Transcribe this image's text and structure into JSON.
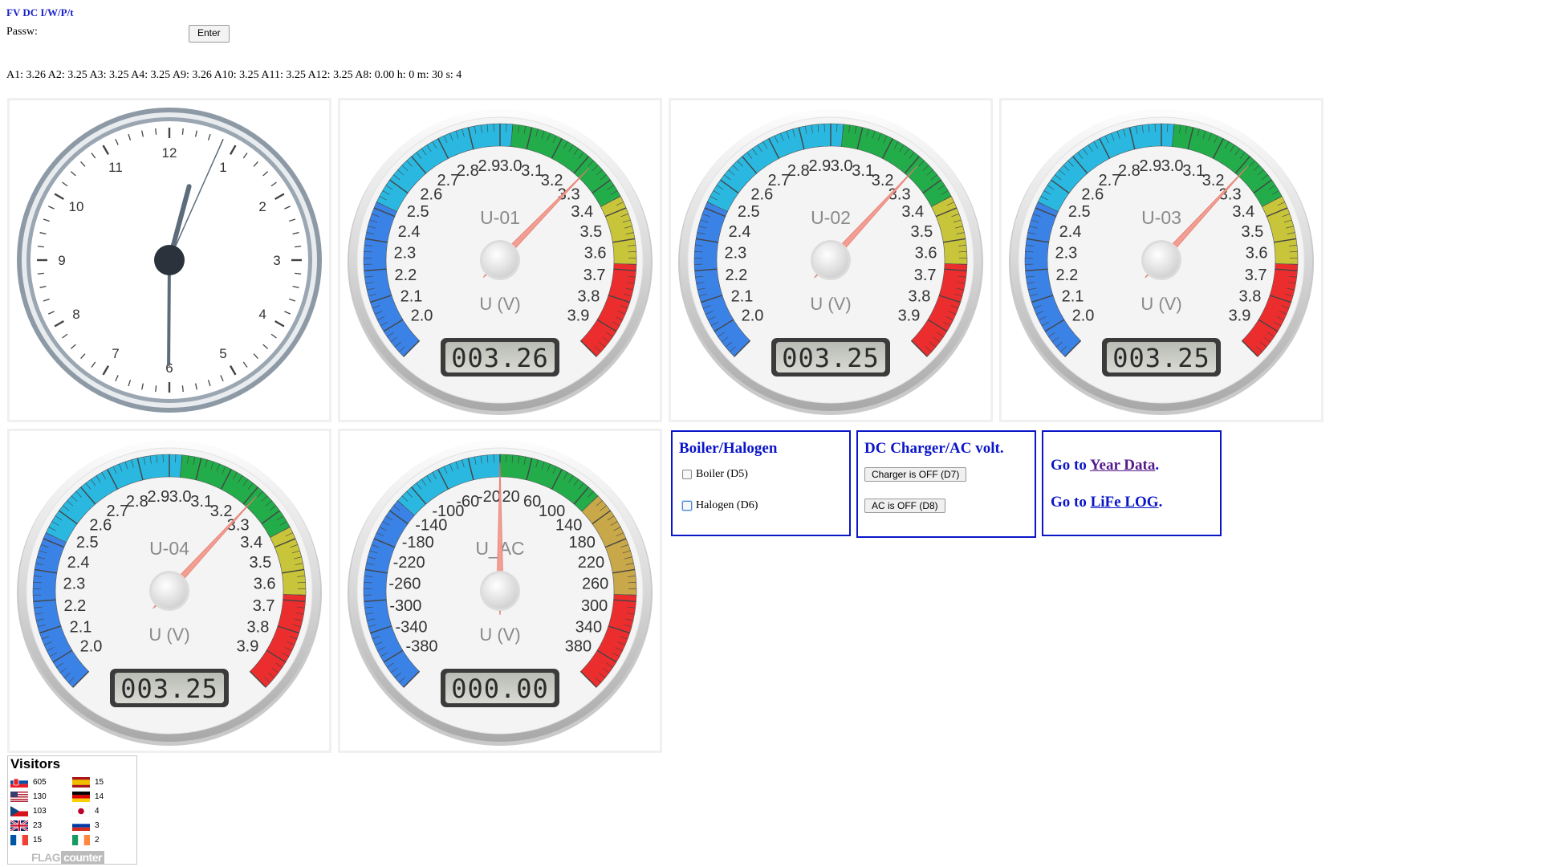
{
  "header": {
    "title": "FV DC I/W/P/t",
    "passw_label": "Passw:",
    "enter_label": "Enter"
  },
  "readings_line": "A1: 3.26 A2: 3.25 A3: 3.25 A4: 3.25 A9: 3.26 A10: 3.25 A11: 3.25 A12: 3.25 A8: 0.00 h: 0 m: 30 s: 4",
  "clock": {
    "numbers": [
      "12",
      "1",
      "2",
      "3",
      "4",
      "5",
      "6",
      "7",
      "8",
      "9",
      "10",
      "11"
    ],
    "hour": 0,
    "minute": 30,
    "second": 4
  },
  "gauges": [
    {
      "id": "U-01",
      "unit": "U (V)",
      "value": 3.26,
      "display": "003.26"
    },
    {
      "id": "U-02",
      "unit": "U (V)",
      "value": 3.25,
      "display": "003.25"
    },
    {
      "id": "U-03",
      "unit": "U (V)",
      "value": 3.25,
      "display": "003.25"
    },
    {
      "id": "U-04",
      "unit": "U (V)",
      "value": 3.25,
      "display": "003.25"
    },
    {
      "id": "U_AC",
      "unit": "U (V)",
      "value": 0.0,
      "display": "000.00"
    }
  ],
  "dc_scale": {
    "labels": [
      "2.0",
      "2.1",
      "2.2",
      "2.3",
      "2.4",
      "2.5",
      "2.6",
      "2.7",
      "2.8",
      "2.9",
      "3.0",
      "3.1",
      "3.2",
      "3.3",
      "3.4",
      "3.5",
      "3.6",
      "3.7",
      "3.8",
      "3.9"
    ],
    "min": 2.0,
    "max": 3.9
  },
  "ac_scale": {
    "labels": [
      "-380",
      "-340",
      "-300",
      "-260",
      "-220",
      "-180",
      "-140",
      "-100",
      "-60",
      "-20",
      "20",
      "60",
      "100",
      "140",
      "180",
      "220",
      "260",
      "300",
      "340",
      "380"
    ],
    "min": -400,
    "max": 400
  },
  "colors": {
    "blue": "#3b82e6",
    "cyan": "#2ab8e0",
    "green": "#22ac4a",
    "yellow": "#c9c53a",
    "red": "#ec2d2d",
    "needle": "#f39e93",
    "link_blue": "#0a15c8",
    "visited": "#551a8b"
  },
  "boiler_box": {
    "title": "Boiler/Halogen",
    "boiler_label": "Boiler (D5)",
    "halogen_label": "Halogen (D6)"
  },
  "charger_box": {
    "title": "DC Charger/AC volt.",
    "charger_button": "Charger is OFF (D7)",
    "ac_button": "AC is OFF (D8)"
  },
  "links": {
    "goto_text": "Go to",
    "year_data": "Year Data",
    "life_log": "LiFe LOG",
    "period": "."
  },
  "visitors": {
    "title": "Visitors",
    "left": [
      {
        "flag": "slovakia-flag",
        "count": "605"
      },
      {
        "flag": "usa-flag",
        "count": "130"
      },
      {
        "flag": "czech-flag",
        "count": "103"
      },
      {
        "flag": "uk-flag",
        "count": "23"
      },
      {
        "flag": "france-flag",
        "count": "15"
      }
    ],
    "right": [
      {
        "flag": "spain-flag",
        "count": "15"
      },
      {
        "flag": "germany-flag",
        "count": "14"
      },
      {
        "flag": "japan-flag",
        "count": "4"
      },
      {
        "flag": "russia-flag",
        "count": "3"
      },
      {
        "flag": "ireland-flag",
        "count": "2"
      }
    ],
    "logo_a": "FLAG",
    "logo_b": "counter"
  }
}
